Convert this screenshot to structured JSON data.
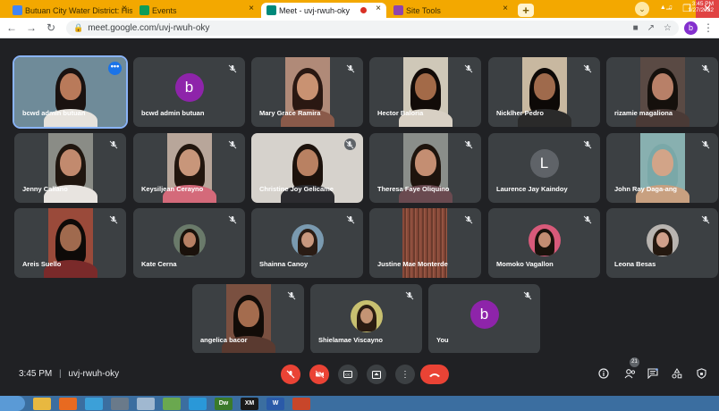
{
  "browser": {
    "tabs": [
      {
        "title": "Butuan City Water District: Histor",
        "favicon": "calendar-icon",
        "color": "#4285f4",
        "active": false
      },
      {
        "title": "Events",
        "favicon": "site-icon",
        "color": "#0f9d58",
        "active": false
      },
      {
        "title": "Meet - uvj-rwuh-oky",
        "favicon": "meet-icon",
        "color": "#00897b",
        "active": true,
        "recording": true
      },
      {
        "title": "Site Tools",
        "favicon": "site-tools-icon",
        "color": "#8e44ad",
        "active": false
      }
    ],
    "new_tab": "+",
    "address": "meet.google.com/uvj-rwuh-oky",
    "profile_initial": "b"
  },
  "participants": [
    {
      "name": "bcwd admin butuan",
      "type": "video",
      "skin": "#b97a5a",
      "hair": "#1a1210",
      "shirt": "#e6e2dc",
      "bg": "#6f8b99",
      "pinned": true,
      "muted": false,
      "more": "•••"
    },
    {
      "name": "bcwd admin butuan",
      "type": "letter",
      "letter": "b",
      "color": "#8e24aa",
      "muted": true
    },
    {
      "name": "Mary Grace Ramira",
      "type": "video",
      "skin": "#c99272",
      "hair": "#2a1812",
      "shirt": "#8a5a4a",
      "bg": "#b08a78",
      "muted": true
    },
    {
      "name": "Hector Baloria",
      "type": "video",
      "skin": "#a36a48",
      "hair": "#120b08",
      "shirt": "#d8d0c4",
      "bg": "#cfc8b8",
      "muted": true
    },
    {
      "name": "Nicklher Pedro",
      "type": "video",
      "skin": "#9f6a4c",
      "hair": "#0d0907",
      "shirt": "#2a2a2a",
      "bg": "#c8b8a0",
      "muted": true
    },
    {
      "name": "rizamie magaliona",
      "type": "video",
      "skin": "#b88068",
      "hair": "#15100c",
      "shirt": "#4a3a36",
      "bg": "#5a4a44",
      "muted": true
    },
    {
      "name": "Jenny Callano",
      "type": "video",
      "skin": "#c28a6e",
      "hair": "#20160f",
      "shirt": "#e8e4e0",
      "bg": "#8a8c86",
      "muted": true
    },
    {
      "name": "Keysiljean Cerayno",
      "type": "video",
      "skin": "#c8967a",
      "hair": "#22160e",
      "shirt": "#d46a7a",
      "bg": "#b8a69a",
      "muted": true
    },
    {
      "name": "Christine Joy Gelicame",
      "type": "video",
      "skin": "#b98162",
      "hair": "#1c120c",
      "shirt": "#2c2c30",
      "bg": "#d6d2cc",
      "muted": true,
      "wide": true
    },
    {
      "name": "Theresa Faye Oliquino",
      "type": "video",
      "skin": "#c48e72",
      "hair": "#1e140d",
      "shirt": "#6a4a50",
      "bg": "#8a8e8a",
      "muted": true
    },
    {
      "name": "Laurence Jay Kaindoy",
      "type": "letter",
      "letter": "L",
      "color": "#5f6368",
      "muted": true
    },
    {
      "name": "John Ray Daga-ang",
      "type": "video",
      "skin": "#d2a488",
      "hair": "#7aa8a8",
      "shirt": "#c8a080",
      "bg": "#88b0b0",
      "muted": true
    },
    {
      "name": "Areis Suello",
      "type": "video",
      "skin": "#a06a4e",
      "hair": "#0e0a08",
      "shirt": "#7a2a2a",
      "bg": "#9a4a3a",
      "muted": true
    },
    {
      "name": "Kate Cerna",
      "type": "thumb",
      "skin": "#b78064",
      "hair": "#1a110b",
      "bg": "#6a7a6a",
      "muted": true
    },
    {
      "name": "Shainna Canoy",
      "type": "thumb",
      "skin": "#c8987e",
      "hair": "#2a1c14",
      "bg": "#7a9ab0",
      "muted": true
    },
    {
      "name": "Justine Mae Monterde",
      "type": "texture",
      "bg": "#8a4a3a",
      "muted": true
    },
    {
      "name": "Momoko Vagallon",
      "type": "thumb",
      "skin": "#c28c72",
      "hair": "#1a120c",
      "bg": "#d85a7a",
      "muted": true
    },
    {
      "name": "Leona Besas",
      "type": "thumb",
      "skin": "#d0a08a",
      "hair": "#24180f",
      "bg": "#b8b4b0",
      "muted": true
    },
    {
      "name": "angelica bacor",
      "type": "video",
      "skin": "#a46c4e",
      "hair": "#120c08",
      "shirt": "#5a3a30",
      "bg": "#7a5040",
      "muted": true
    },
    {
      "name": "Shielamae Viscayno",
      "type": "thumb",
      "skin": "#c49474",
      "hair": "#2a1c12",
      "bg": "#c8c070",
      "muted": true
    },
    {
      "name": "You",
      "type": "letter",
      "letter": "b",
      "color": "#8e24aa",
      "muted": true
    }
  ],
  "bottom": {
    "time": "3:45 PM",
    "separator": "|",
    "meeting_code": "uvj-rwuh-oky",
    "people_count": "21",
    "accent_red": "#ea4335"
  },
  "taskbar": {
    "clock_time": "3:45 PM",
    "clock_date": "1/27/2022",
    "apps": [
      {
        "icon": "folder-icon",
        "color": "#e8b840"
      },
      {
        "icon": "firefox-icon",
        "color": "#e86a20"
      },
      {
        "icon": "chrome-icon",
        "color": "#3ca0d8"
      },
      {
        "icon": "steam-icon",
        "color": "#6a7a8a"
      },
      {
        "icon": "calculator-icon",
        "color": "#a0b8d0"
      },
      {
        "icon": "paint-icon",
        "color": "#6aa84f"
      },
      {
        "icon": "skype-icon",
        "color": "#2a98d8"
      },
      {
        "icon": "dreamweaver-icon",
        "color": "#3a7a2a",
        "text": "Dw"
      },
      {
        "icon": "xm-icon",
        "color": "#1a1a1a",
        "text": "XM"
      },
      {
        "icon": "word-icon",
        "color": "#2a5aa8",
        "text": "W"
      },
      {
        "icon": "chrome-active-icon",
        "color": "#c8462a"
      }
    ]
  }
}
